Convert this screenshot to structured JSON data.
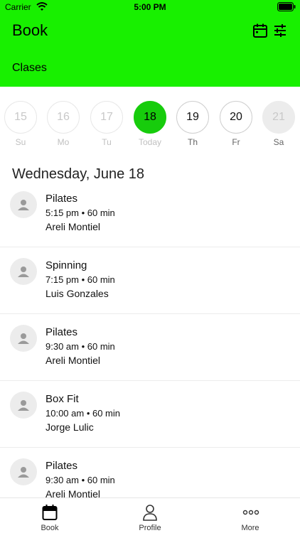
{
  "status_bar": {
    "carrier": "Carrier",
    "time": "5:00 PM"
  },
  "header": {
    "title": "Book",
    "subtitle": "Clases"
  },
  "days": [
    {
      "number": "15",
      "label": "Su",
      "state": "past"
    },
    {
      "number": "16",
      "label": "Mo",
      "state": "past"
    },
    {
      "number": "17",
      "label": "Tu",
      "state": "past"
    },
    {
      "number": "18",
      "label": "Today",
      "state": "active"
    },
    {
      "number": "19",
      "label": "Th",
      "state": "upcoming"
    },
    {
      "number": "20",
      "label": "Fr",
      "state": "upcoming"
    },
    {
      "number": "21",
      "label": "Sa",
      "state": "grey"
    }
  ],
  "date_heading": "Wednesday, June 18",
  "classes": [
    {
      "name": "Pilates",
      "time": "5:15 pm • 60 min",
      "instructor": "Areli Montiel"
    },
    {
      "name": "Spinning",
      "time": "7:15 pm • 60 min",
      "instructor": "Luis Gonzales"
    },
    {
      "name": "Pilates",
      "time": "9:30 am • 60 min",
      "instructor": "Areli Montiel"
    },
    {
      "name": "Box Fit",
      "time": "10:00 am • 60 min",
      "instructor": "Jorge Lulic"
    },
    {
      "name": "Pilates",
      "time": "9:30 am • 60 min",
      "instructor": "Areli Montiel"
    }
  ],
  "tabs": [
    {
      "label": "Book",
      "icon": "calendar-icon"
    },
    {
      "label": "Profile",
      "icon": "person-icon"
    },
    {
      "label": "More",
      "icon": "more-icon"
    }
  ],
  "colors": {
    "header_green": "#18f000",
    "active_day_green": "#17cc0c"
  }
}
